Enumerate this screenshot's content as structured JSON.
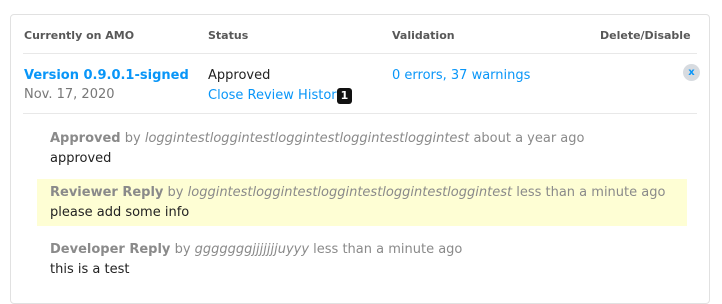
{
  "headers": {
    "amo": "Currently on AMO",
    "status": "Status",
    "validation": "Validation",
    "delete": "Delete/Disable"
  },
  "version": {
    "link": "Version 0.9.0.1-signed",
    "date": "Nov. 17, 2020",
    "status": "Approved",
    "close_history": "Close Review History",
    "badge": "1",
    "validation": "0 errors, 37 warnings",
    "delete_label": "x"
  },
  "history": [
    {
      "action": "Approved",
      "by": "by",
      "user": "loggintestloggintestloggintestloggintestloggintest",
      "when": "about a year ago",
      "comment": "approved",
      "highlight": false
    },
    {
      "action": "Reviewer Reply",
      "by": "by",
      "user": "loggintestloggintestloggintestloggintestloggintest",
      "when": "less than a minute ago",
      "comment": "please add some info",
      "highlight": true
    },
    {
      "action": "Developer Reply",
      "by": "by",
      "user": "gggggggjjjjjjjuyyy",
      "when": "less than a minute ago",
      "comment": "this is a test",
      "highlight": false
    }
  ],
  "colors": {
    "link": "#0996f8",
    "highlight": "#fefed4"
  }
}
